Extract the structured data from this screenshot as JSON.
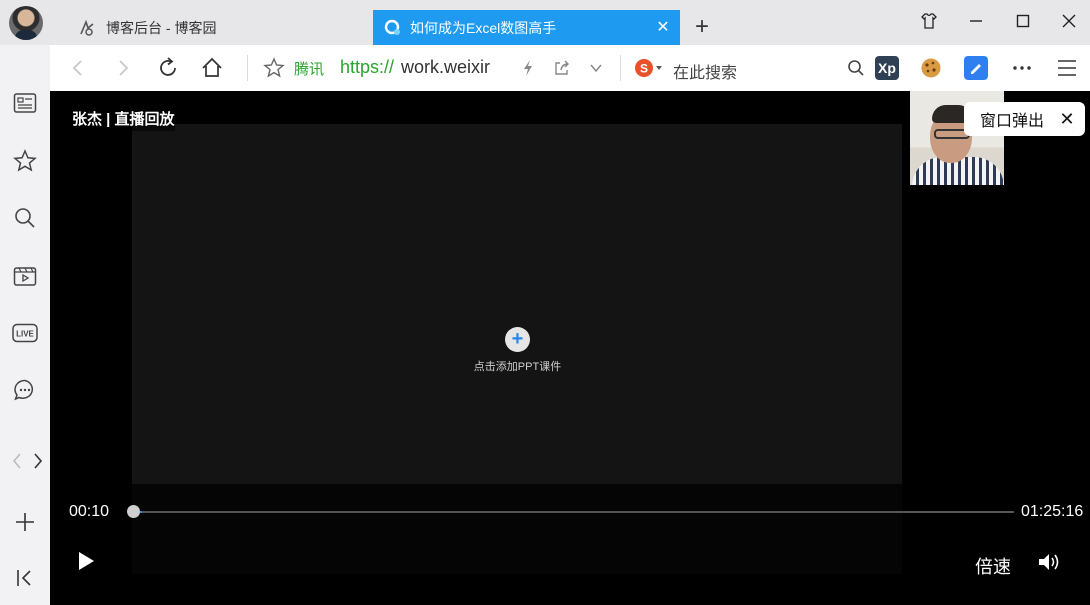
{
  "tabs": [
    {
      "title": "博客后台 - 博客园",
      "icon": "blog-icon"
    },
    {
      "title": "如何成为Excel数图高手",
      "icon": "tencent-meeting-icon",
      "active": true
    }
  ],
  "tab_close": "✕",
  "new_tab": "+",
  "address": {
    "site_badge": "腾讯",
    "scheme": "https://",
    "host": "work.weixir"
  },
  "search": {
    "placeholder": "在此搜索"
  },
  "extensions": {
    "xp": "Xp"
  },
  "sidebar": {
    "items": [
      "news-icon",
      "star-icon",
      "search-icon",
      "video-icon",
      "live-icon",
      "chat-icon",
      "prev-next-icon",
      "add-icon",
      "collapse-icon"
    ],
    "live_label": "LIVE"
  },
  "player": {
    "presenter": "张杰 | 直播回放",
    "add_ppt": "+",
    "add_ppt_label": "点击添加PPT课件",
    "popout_label": "窗口弹出",
    "popout_close": "✕",
    "current_time": "00:10",
    "total_time": "01:25:16",
    "progress_fraction": 0.002,
    "speed_label": "倍速"
  },
  "colors": {
    "accent": "#1e9bf0",
    "url_green": "#2aa52f",
    "progress": "#1e88e5"
  }
}
